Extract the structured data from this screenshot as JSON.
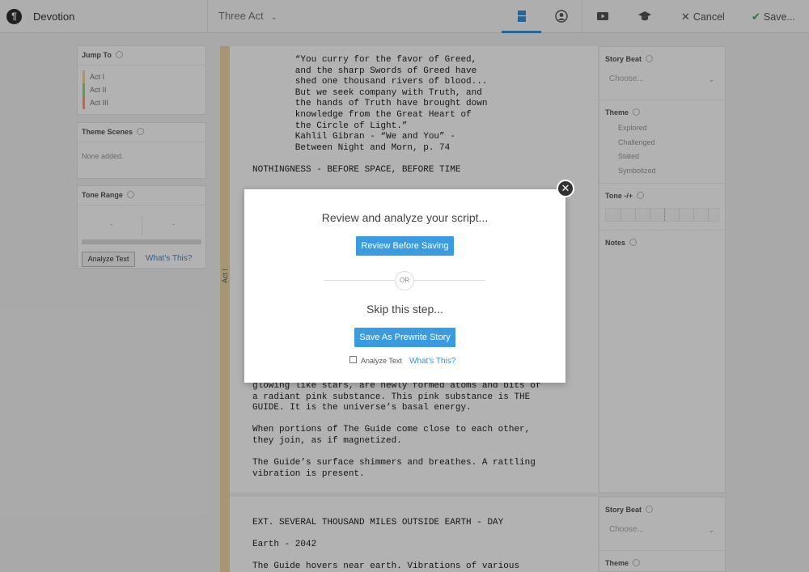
{
  "app": {
    "title": "Devotion",
    "logo": "¶"
  },
  "topbar": {
    "structure_label": "Three Act",
    "icons": [
      "outline-view-icon",
      "character-icon",
      "video-icon",
      "graduation-cap-icon"
    ],
    "cancel_label": "Cancel",
    "save_label": "Save..."
  },
  "sidebar": {
    "jump_to": {
      "title": "Jump To",
      "acts": [
        {
          "label": "Act I",
          "color": "#ecd9a4"
        },
        {
          "label": "Act II",
          "color": "#9fcd9d"
        },
        {
          "label": "Act III",
          "color": "#e8a58e"
        }
      ]
    },
    "theme_scenes": {
      "title": "Theme Scenes",
      "empty_text": "None added."
    },
    "tone_range": {
      "title": "Tone Range",
      "left_value": "-",
      "right_value": "-",
      "analyze_label": "Analyze Text",
      "link_label": "What's This?"
    }
  },
  "script": {
    "act_label": "Act I",
    "scene1_top": [
      "        “You curry for the favor of Greed,",
      "        and the sharp Swords of Greed have",
      "        shed one thousand rivers of blood...",
      "        But we seek company with Truth, and",
      "        the hands of Truth have brought down",
      "        knowledge from the Great Heart of",
      "        the Circle of Light.”",
      "        Kahlil Gibran - “We and You” -",
      "        Between Night and Morn, p. 74",
      "",
      "NOTHINGNESS - BEFORE SPACE, BEFORE TIME"
    ],
    "scene1_bottom": [
      "glowing like stars, are newly formed atoms and bits of",
      "a radiant pink substance. This pink substance is THE",
      "GUIDE. It is the universe’s basal energy.",
      "",
      "When portions of The Guide come close to each other,",
      "they join, as if magnetized.",
      "",
      "The Guide’s surface shimmers and breathes. A rattling",
      "vibration is present."
    ],
    "scene2": [
      "EXT. SEVERAL THOUSAND MILES OUTSIDE EARTH - DAY",
      "",
      "Earth - 2042",
      "",
      "The Guide hovers near earth. Vibrations of various"
    ]
  },
  "right_panel": {
    "story_beat": {
      "title": "Story Beat",
      "placeholder": "Choose..."
    },
    "theme": {
      "title": "Theme",
      "options": [
        "Explored",
        "Challenged",
        "Stated",
        "Symbolized"
      ]
    },
    "tone": {
      "title": "Tone -/+"
    },
    "notes": {
      "title": "Notes"
    }
  },
  "modal": {
    "title": "Review and analyze your script...",
    "review_button": "Review Before Saving",
    "or_text": "OR",
    "skip_title": "Skip this step...",
    "save_button": "Save As Prewrite Story",
    "analyze_checkbox_label": "Analyze Text",
    "analyze_checked": false,
    "whats_this": "What's This?",
    "close_symbol": "✕"
  }
}
